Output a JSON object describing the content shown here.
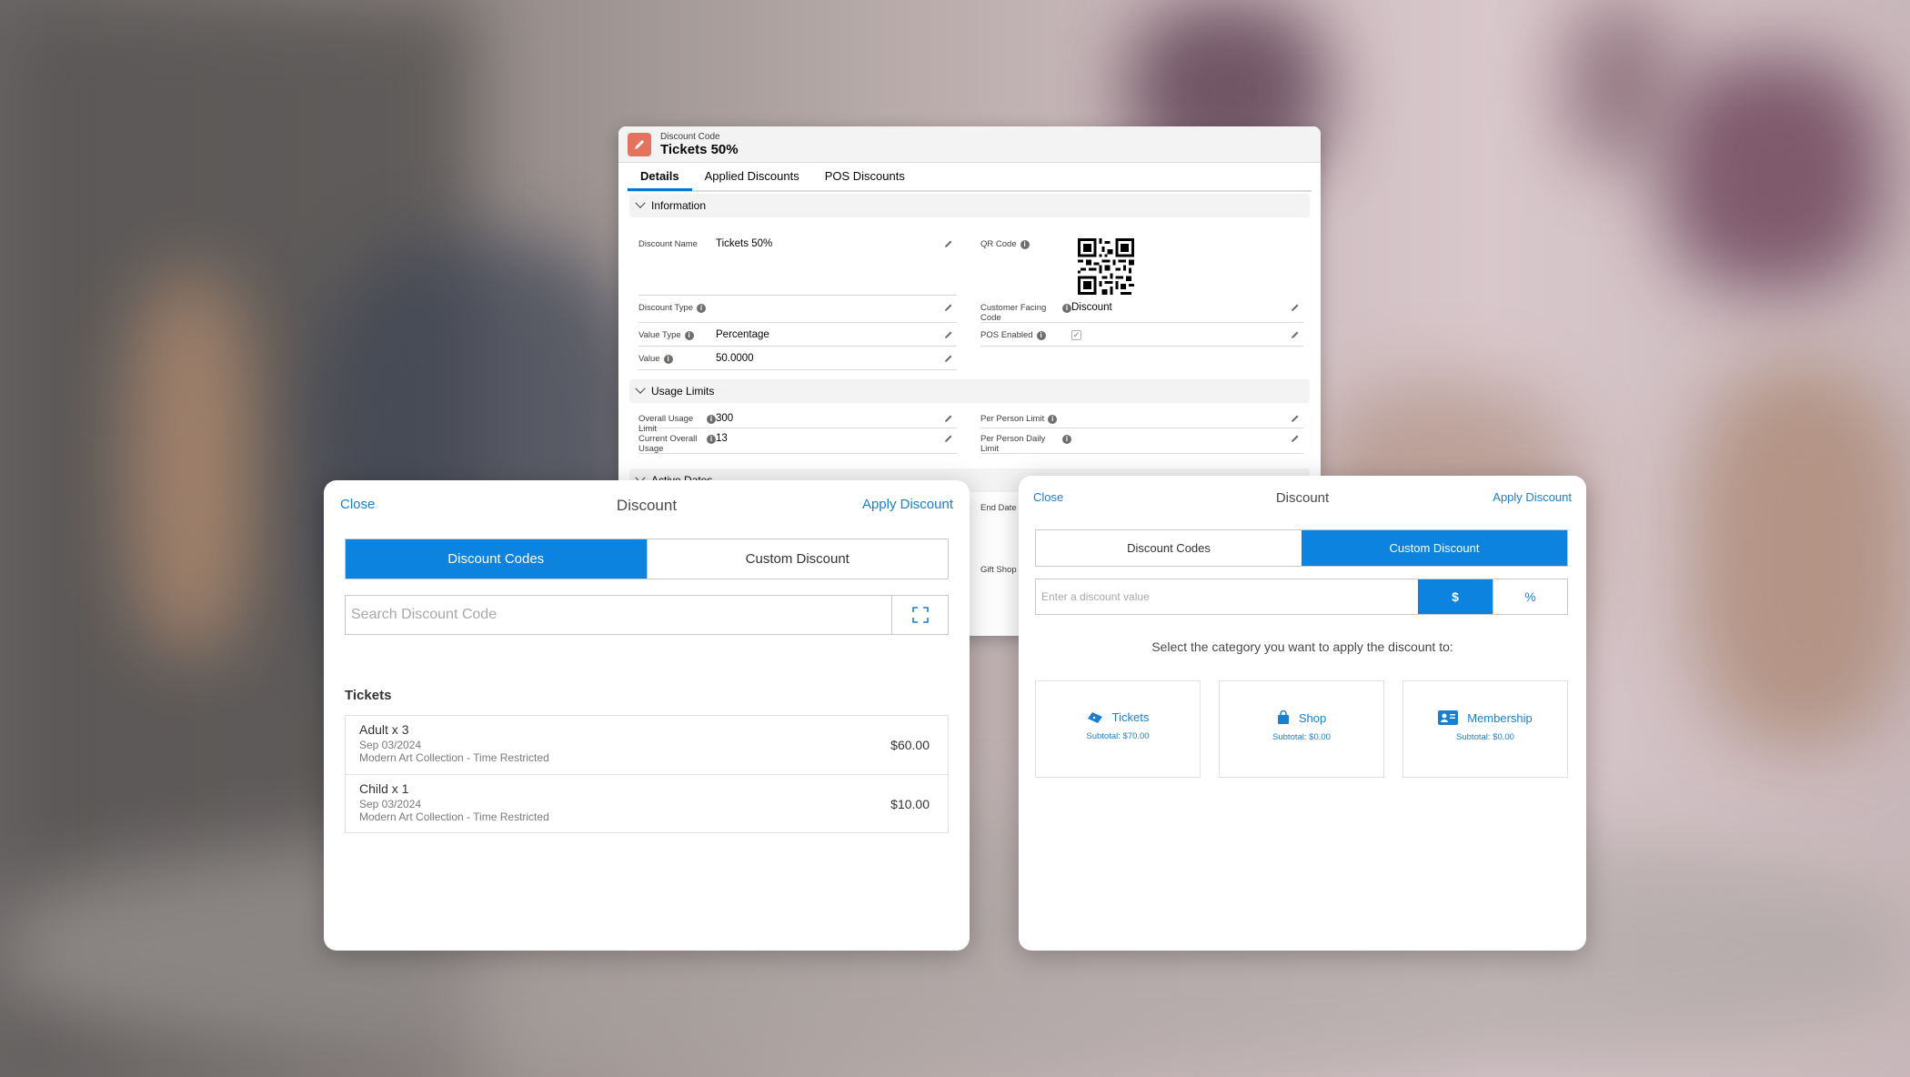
{
  "record": {
    "object_label": "Discount Code",
    "title": "Tickets 50%",
    "tabs": [
      "Details",
      "Applied Discounts",
      "POS Discounts"
    ],
    "sections": {
      "information": "Information",
      "usage_limits": "Usage Limits",
      "active_dates": "Active Dates"
    },
    "fields": {
      "discount_name_label": "Discount Name",
      "discount_name": "Tickets 50%",
      "qr_code_label": "QR Code",
      "discount_type_label": "Discount Type",
      "customer_facing_code_label": "Customer Facing Code",
      "customer_facing_code": "Discount",
      "value_type_label": "Value Type",
      "value_type": "Percentage",
      "pos_enabled_label": "POS Enabled",
      "value_label": "Value",
      "value": "50.0000",
      "overall_usage_limit_label": "Overall Usage Limit",
      "overall_usage_limit": "300",
      "per_person_limit_label": "Per Person Limit",
      "current_overall_usage_label": "Current Overall Usage",
      "current_overall_usage": "13",
      "per_person_daily_limit_label": "Per Person Daily Limit",
      "end_date_label": "End Date",
      "gift_shop_label": "Gift Shop"
    }
  },
  "modal_left": {
    "close": "Close",
    "title": "Discount",
    "apply": "Apply Discount",
    "seg_codes": "Discount Codes",
    "seg_custom": "Custom Discount",
    "search_placeholder": "Search Discount Code",
    "tickets_heading": "Tickets",
    "items": [
      {
        "name": "Adult x 3",
        "date": "Sep 03/2024",
        "desc": "Modern Art Collection - Time Restricted",
        "price": "$60.00"
      },
      {
        "name": "Child x 1",
        "date": "Sep 03/2024",
        "desc": "Modern Art Collection - Time Restricted",
        "price": "$10.00"
      }
    ]
  },
  "modal_right": {
    "close": "Close",
    "title": "Discount",
    "apply": "Apply Discount",
    "seg_codes": "Discount Codes",
    "seg_custom": "Custom Discount",
    "value_placeholder": "Enter a discount value",
    "unit_dollar": "$",
    "unit_percent": "%",
    "select_text": "Select the category you want to apply the discount to:",
    "categories": [
      {
        "label": "Tickets",
        "subtotal": "Subtotal: $70.00",
        "icon": "ticket-icon"
      },
      {
        "label": "Shop",
        "subtotal": "Subtotal: $0.00",
        "icon": "shopping-bag-icon"
      },
      {
        "label": "Membership",
        "subtotal": "Subtotal: $0.00",
        "icon": "membership-card-icon"
      }
    ]
  },
  "colors": {
    "accent": "#0c84df",
    "link": "#1b7fd0",
    "record_icon": "#e3735e"
  }
}
